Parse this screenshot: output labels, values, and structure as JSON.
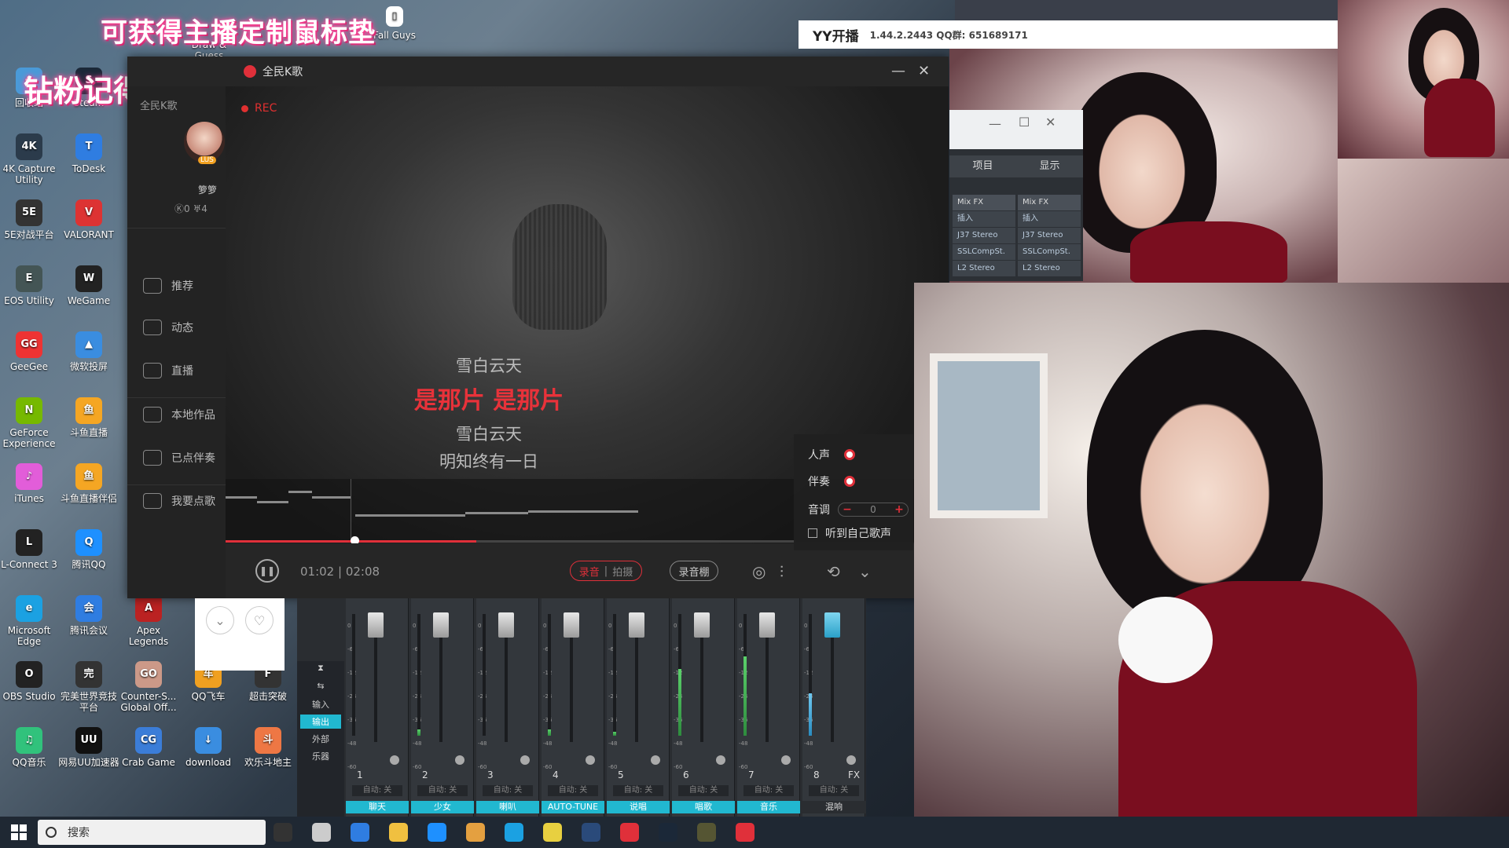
{
  "desktop_icons": [
    {
      "label": "回收站",
      "color": "#4a9ad8",
      "glyph": "♻"
    },
    {
      "label": "Steam",
      "color": "#1b2838",
      "glyph": "S"
    },
    {
      "label": "4K Capture Utility",
      "color": "#2b3b4b",
      "glyph": "4K"
    },
    {
      "label": "ToDesk",
      "color": "#2f7de1",
      "glyph": "T"
    },
    {
      "label": "5E对战平台",
      "color": "#333",
      "glyph": "5E"
    },
    {
      "label": "VALORANT",
      "color": "#d33",
      "glyph": "V"
    },
    {
      "label": "EOS Utility",
      "color": "#455",
      "glyph": "E"
    },
    {
      "label": "WeGame",
      "color": "#222",
      "glyph": "W"
    },
    {
      "label": "GeeGee",
      "color": "#e33",
      "glyph": "GG"
    },
    {
      "label": "微软投屏",
      "color": "#3a8de0",
      "glyph": "▲"
    },
    {
      "label": "GeForce Experience",
      "color": "#76b900",
      "glyph": "N"
    },
    {
      "label": "斗鱼直播",
      "color": "#f5a623",
      "glyph": "鱼"
    },
    {
      "label": "iTunes",
      "color": "#e25dd9",
      "glyph": "♪"
    },
    {
      "label": "斗鱼直播伴侣",
      "color": "#f5a623",
      "glyph": "鱼"
    },
    {
      "label": "L-Connect 3",
      "color": "#222",
      "glyph": "L"
    },
    {
      "label": "腾讯QQ",
      "color": "#1e90ff",
      "glyph": "Q"
    },
    {
      "label": "Microsoft Edge",
      "color": "#1ba1e2",
      "glyph": "e"
    },
    {
      "label": "腾讯会议",
      "color": "#2f7de1",
      "glyph": "会"
    },
    {
      "label": "Apex Legends",
      "color": "#b22",
      "glyph": "A"
    },
    {
      "label": "OBS Studio",
      "color": "#222",
      "glyph": "O"
    },
    {
      "label": "完美世界竞技平台",
      "color": "#333",
      "glyph": "完"
    },
    {
      "label": "Counter-S... Global Off...",
      "color": "#c98",
      "glyph": "GO"
    },
    {
      "label": "QQ飞车",
      "color": "#f0a020",
      "glyph": "车"
    },
    {
      "label": "超击突破",
      "color": "#333",
      "glyph": "F"
    },
    {
      "label": "QQ音乐",
      "color": "#31c27c",
      "glyph": "♫"
    },
    {
      "label": "网易UU加速器",
      "color": "#111",
      "glyph": "UU"
    },
    {
      "label": "Crab Game",
      "color": "#3b7dd8",
      "glyph": "CG"
    },
    {
      "label": "download",
      "color": "#3a8de0",
      "glyph": "↓"
    },
    {
      "label": "欢乐斗地主",
      "color": "#e74",
      "glyph": "斗"
    }
  ],
  "top_icons": [
    "Fall Guys",
    "Draw & Guess"
  ],
  "overlay": {
    "line1": "可获得主播定制鼠标垫",
    "line2": "钻粉记得打卡♥"
  },
  "karaoke": {
    "title": "全民K歌",
    "sidebar_title": "全民K歌",
    "user": {
      "name": "箩箩",
      "level": "LUS",
      "stats": "Ⓚ0  ♅4"
    },
    "nav": [
      "推荐",
      "动态",
      "直播",
      "本地作品",
      "已点伴奏",
      "我要点歌"
    ],
    "rec_label": "REC",
    "lyrics": [
      "雪白云天",
      "是那片 是那片",
      "雪白云天",
      "明知终有一日"
    ],
    "progress": 0.44,
    "time": "01:02 | 02:08",
    "mode_active": "录音",
    "mode_inactive": "拍摄",
    "record_shed": "录音棚",
    "audio_panel": {
      "vocal": "人声",
      "accompaniment": "伴奏",
      "pitch_label": "音调",
      "pitch_value": "0",
      "pitch_minus": "−",
      "pitch_plus": "+",
      "hear_self": "听到自己歌声"
    }
  },
  "mixer": {
    "left_items": [
      "输入",
      "输出",
      "外部",
      "乐器"
    ],
    "channels": [
      {
        "num": "1",
        "label": "聊天",
        "auto": "自动: 关",
        "level": 0.0
      },
      {
        "num": "2",
        "label": "少女",
        "auto": "自动: 关",
        "level": 0.05
      },
      {
        "num": "3",
        "label": "喇叭",
        "auto": "自动: 关",
        "level": 0.0
      },
      {
        "num": "4",
        "label": "AUTO-TUNE",
        "auto": "自动: 关",
        "level": 0.05
      },
      {
        "num": "5",
        "label": "说唱",
        "auto": "自动: 关",
        "level": 0.03
      },
      {
        "num": "6",
        "label": "唱歌",
        "auto": "自动: 关",
        "level": 0.55
      },
      {
        "num": "7",
        "label": "音乐",
        "auto": "自动: 关",
        "level": 0.65
      },
      {
        "num": "8",
        "label": "混响",
        "auto": "自动: 关",
        "level": 0.35,
        "fx": "FX"
      }
    ],
    "scale": [
      "0",
      "-6",
      "-12",
      "-24",
      "-36",
      "-48",
      "-60"
    ]
  },
  "yy": {
    "name": "YY开播",
    "version": "1.44.2.2443  QQ群: 651689171"
  },
  "fxwin": {
    "tabs": [
      "项目",
      "显示"
    ],
    "cols": [
      [
        "Mix FX",
        "插入",
        "J37 Stereo",
        "SSLCompSt.",
        "L2 Stereo"
      ],
      [
        "Mix FX",
        "插入",
        "J37 Stereo",
        "SSLCompSt.",
        "L2 Stereo"
      ]
    ]
  },
  "taskbar": {
    "search": "搜索"
  },
  "colors": {
    "accent": "#e0303a",
    "cyan": "#21b8d0"
  }
}
